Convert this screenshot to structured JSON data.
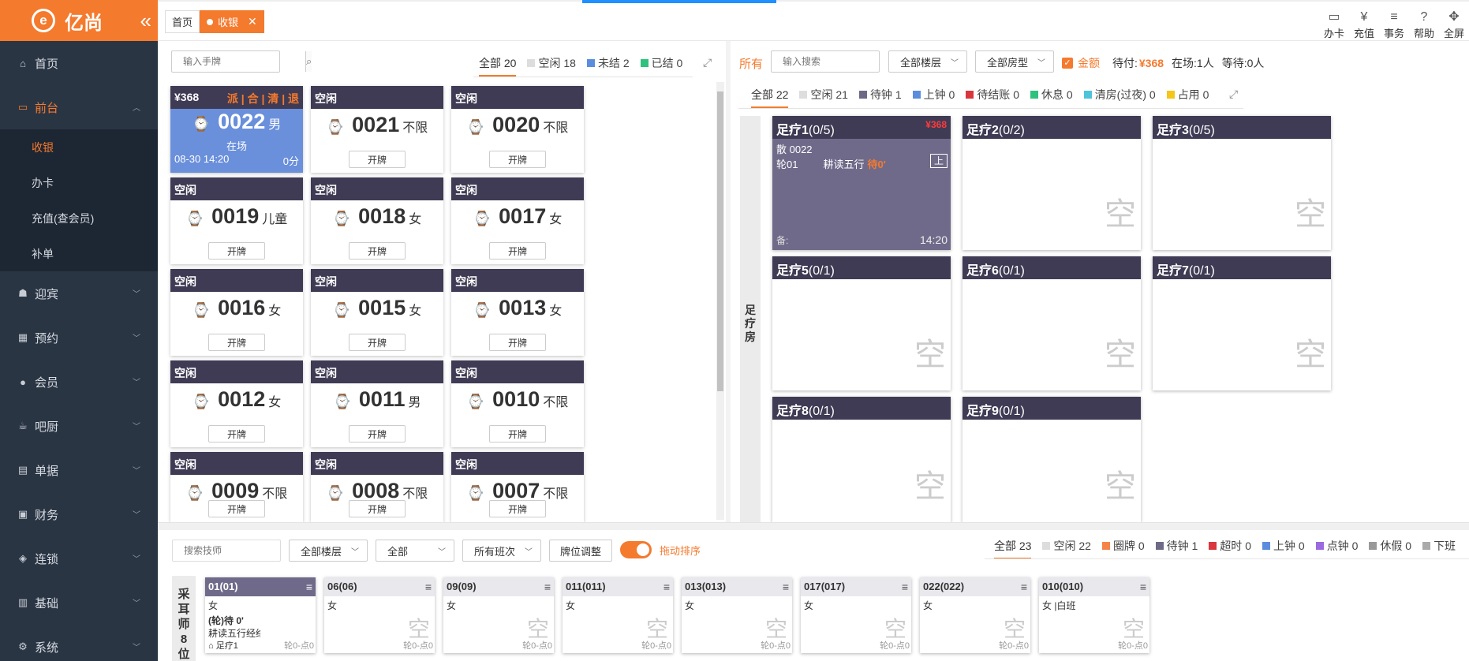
{
  "app": {
    "name": "亿尚"
  },
  "sidebar": {
    "items": [
      {
        "label": "首页",
        "icon": "home-icon"
      },
      {
        "label": "前台",
        "icon": "monitor-icon",
        "active": true,
        "sub": [
          {
            "label": "收银",
            "active": true
          },
          {
            "label": "办卡"
          },
          {
            "label": "充值(查会员)"
          },
          {
            "label": "补单"
          }
        ]
      },
      {
        "label": "迎宾",
        "icon": "reception-icon"
      },
      {
        "label": "预约",
        "icon": "calendar-icon"
      },
      {
        "label": "会员",
        "icon": "user-icon"
      },
      {
        "label": "吧厨",
        "icon": "cup-icon"
      },
      {
        "label": "单据",
        "icon": "document-icon"
      },
      {
        "label": "财务",
        "icon": "finance-icon"
      },
      {
        "label": "连锁",
        "icon": "chain-icon"
      },
      {
        "label": "基础",
        "icon": "base-icon"
      },
      {
        "label": "系统",
        "icon": "gear-icon"
      }
    ]
  },
  "tabs": {
    "home": "首页",
    "current": "收银"
  },
  "toolbar": {
    "card": "办卡",
    "recharge": "充值",
    "affairs": "事务",
    "help": "帮助",
    "fullscreen": "全屏"
  },
  "left": {
    "search_placeholder": "输入手牌",
    "filters": [
      {
        "label": "全部 20",
        "color": ""
      },
      {
        "label": "空闲 18",
        "color": "#dddddd"
      },
      {
        "label": "未结 2",
        "color": "#5b8dde"
      },
      {
        "label": "已结 0",
        "color": "#2ec27e"
      }
    ],
    "open_label": "开牌",
    "busy_card": {
      "price": "¥368",
      "actions": "派 | 合 | 清 | 退",
      "num": "0022",
      "gender": "男",
      "status": "在场",
      "time": "08-30 14:20",
      "score": "0分"
    },
    "cards": [
      {
        "status": "空闲",
        "num": "0021",
        "gender": "不限"
      },
      {
        "status": "空闲",
        "num": "0020",
        "gender": "不限"
      },
      {
        "status": "空闲",
        "num": "0019",
        "gender": "儿童"
      },
      {
        "status": "空闲",
        "num": "0018",
        "gender": "女"
      },
      {
        "status": "空闲",
        "num": "0017",
        "gender": "女"
      },
      {
        "status": "空闲",
        "num": "0016",
        "gender": "女"
      },
      {
        "status": "空闲",
        "num": "0015",
        "gender": "女"
      },
      {
        "status": "空闲",
        "num": "0013",
        "gender": "女"
      },
      {
        "status": "空闲",
        "num": "0012",
        "gender": "女"
      },
      {
        "status": "空闲",
        "num": "0011",
        "gender": "男"
      },
      {
        "status": "空闲",
        "num": "0010",
        "gender": "不限"
      },
      {
        "status": "空闲",
        "num": "0009",
        "gender": "不限"
      },
      {
        "status": "空闲",
        "num": "0008",
        "gender": "不限"
      },
      {
        "status": "空闲",
        "num": "0007",
        "gender": "不限"
      }
    ]
  },
  "right": {
    "all_label": "所有",
    "search_placeholder": "输入搜索",
    "floor_select": "全部楼层",
    "type_select": "全部房型",
    "amount_label": "金额",
    "pending_label": "待付:",
    "pending_value": "¥368",
    "present": "在场:1人",
    "waiting": "等待:0人",
    "filters": [
      {
        "label": "全部 22",
        "color": ""
      },
      {
        "label": "空闲 21",
        "color": "#dddddd"
      },
      {
        "label": "待钟 1",
        "color": "#6e6a86"
      },
      {
        "label": "上钟 0",
        "color": "#5b8dde"
      },
      {
        "label": "待结账 0",
        "color": "#d9363e"
      },
      {
        "label": "休息 0",
        "color": "#2ec27e"
      },
      {
        "label": "清房(过夜) 0",
        "color": "#4fc3d9"
      },
      {
        "label": "占用 0",
        "color": "#f5c518"
      }
    ],
    "group_label": "足疗房",
    "empty_mark": "空",
    "busy_room": {
      "name": "足疗1",
      "count": "(0/5)",
      "price": "¥368",
      "line1": "散 0022",
      "line2a": "轮01",
      "line2b": "耕读五行",
      "line2c": "待0'",
      "tag": "上",
      "note": "备:",
      "time": "14:20"
    },
    "rooms": [
      {
        "name": "足疗2",
        "count": "(0/2)"
      },
      {
        "name": "足疗3",
        "count": "(0/5)"
      },
      {
        "name": "足疗5",
        "count": "(0/1)"
      },
      {
        "name": "足疗6",
        "count": "(0/1)"
      },
      {
        "name": "足疗7",
        "count": "(0/1)"
      },
      {
        "name": "足疗8",
        "count": "(0/1)"
      },
      {
        "name": "足疗9",
        "count": "(0/1)"
      }
    ]
  },
  "bottom": {
    "search_placeholder": "搜索技师",
    "floor_select": "全部楼层",
    "all_select": "全部",
    "shift_select": "所有班次",
    "adjust_button": "牌位调整",
    "drag_label": "拖动排序",
    "filters": [
      {
        "label": "全部 23",
        "color": ""
      },
      {
        "label": "空闲 22",
        "color": "#dddddd"
      },
      {
        "label": "圈牌 0",
        "color": "#f4844a"
      },
      {
        "label": "待钟 1",
        "color": "#6e6a86"
      },
      {
        "label": "超时 0",
        "color": "#d9363e"
      },
      {
        "label": "上钟 0",
        "color": "#5b8dde"
      },
      {
        "label": "点钟 0",
        "color": "#9b6ae0"
      },
      {
        "label": "休假 0",
        "color": "#999999"
      },
      {
        "label": "下班",
        "color": "#aaaaaa"
      }
    ],
    "tech_label": "采耳师8位",
    "busy_tech": {
      "name": "01(01)",
      "gender": "女",
      "line1": "(轮)待 0'",
      "line2": "耕读五行经络",
      "room": "足疗1",
      "stat": "轮0-点0"
    },
    "techs": [
      {
        "name": "06(06)",
        "gender": "女",
        "stat": "轮0-点0"
      },
      {
        "name": "09(09)",
        "gender": "女",
        "stat": "轮0-点0"
      },
      {
        "name": "011(011)",
        "gender": "女",
        "stat": "轮0-点0"
      },
      {
        "name": "013(013)",
        "gender": "女",
        "stat": "轮0-点0"
      },
      {
        "name": "017(017)",
        "gender": "女",
        "stat": "轮0-点0"
      },
      {
        "name": "022(022)",
        "gender": "女",
        "stat": "轮0-点0"
      },
      {
        "name": "010(010)",
        "gender": "女 |白班",
        "stat": "轮0-点0"
      }
    ]
  }
}
